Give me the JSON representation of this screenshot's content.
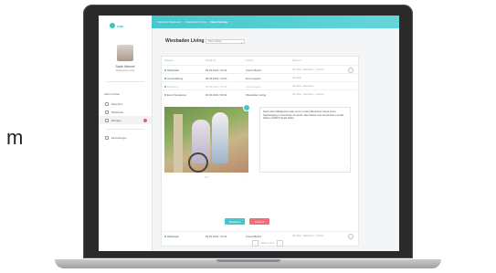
{
  "stray_text": "m",
  "app": {
    "logo_text": "nqo",
    "breadcrumb": [
      "Startseite Wiesbaden",
      "Wiesbaden Living",
      "Neuer Beitrag"
    ]
  },
  "user": {
    "name": "Sarah Mehmet",
    "subtitle": "Wiesbaden Living"
  },
  "sidebar": {
    "heading": "Admin Panel",
    "items": [
      {
        "label": "Bewohner",
        "icon": "user-icon"
      },
      {
        "label": "Mitarbeiter",
        "icon": "staff-icon"
      },
      {
        "label": "Beiträge",
        "icon": "post-icon",
        "active": true,
        "badge": true
      },
      {
        "label": "Einstellungen",
        "icon": "gear-icon"
      }
    ]
  },
  "main": {
    "title": "Wiesbaden Living",
    "location_select": "Filter wählen",
    "columns": [
      "Kategorie",
      "Erstellt am",
      "Autor/in",
      "Aktionen"
    ],
    "rows": [
      {
        "cat": "Mittelstadt",
        "date": "09.03.2016 / 13:41",
        "author": "Ansmit Berlitz",
        "actions": "Neu Bitte · Bearbeiten · Löschen",
        "dot": "#45c7cd"
      },
      {
        "cat": "Veranstaltung",
        "date": "08.03.2016 / 12:00",
        "author": "Eva Langens",
        "actions": "Neu Bitte",
        "dot": "#3dbb6a"
      },
      {
        "cat": "Einladung",
        "date": "06.03.2016 / 10:30",
        "author": "Lisa Langens",
        "actions": "Neu Bitte · Bearbeiten",
        "dot": "#999999",
        "muted": true
      },
      {
        "cat": "Event Neugieren",
        "date": "06.03.2016 / 09:01",
        "author": "Wiesbaden Living",
        "actions": "Neu Bitte · Bearbeiten · Löschen",
        "dot": "#999999"
      }
    ],
    "editor_text": "Nach dem Mittagessen gab es für unsere Bewohner heute einen Spaziergang im herrlichen Kurpark. Das Wetter war wunderbar und alle hatten sichtlich Spaß dabei.",
    "pager_middle": "1/3",
    "save_label": "Speichern",
    "cancel_label": "Löschen",
    "last_row": {
      "cat": "Mittelstadt",
      "date": "09.03.2016 / 13:41",
      "author": "Ansmit Berlitz",
      "actions": "Neu Bitte · Bearbeiten · Löschen",
      "dot": "#45c7cd"
    },
    "pagination_label": "Seite 1 von 4"
  }
}
